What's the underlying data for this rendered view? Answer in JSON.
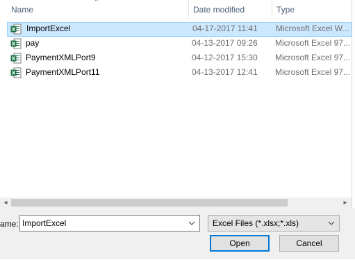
{
  "columns": {
    "name": "Name",
    "date_modified": "Date modified",
    "type": "Type"
  },
  "files": [
    {
      "name": "ImportExcel",
      "date": "04-17-2017 11:41",
      "type": "Microsoft Excel W...",
      "selected": true
    },
    {
      "name": "pay",
      "date": "04-13-2017 09:26",
      "type": "Microsoft Excel 97...",
      "selected": false
    },
    {
      "name": "PaymentXMLPort9",
      "date": "04-12-2017 15:30",
      "type": "Microsoft Excel 97...",
      "selected": false
    },
    {
      "name": "PaymentXMLPort11",
      "date": "04-13-2017 12:41",
      "type": "Microsoft Excel 97...",
      "selected": false
    }
  ],
  "file_name": {
    "label": "ame:",
    "value": "ImportExcel"
  },
  "file_type_filter": "Excel Files (*.xlsx;*.xls)",
  "buttons": {
    "open": "Open",
    "cancel": "Cancel"
  },
  "colors": {
    "selection_bg": "#cce8ff",
    "selection_border": "#99d1ff",
    "excel_green": "#1e7145",
    "focus_border": "#0078d7"
  },
  "icons": {
    "sort": "sort-up-icon",
    "file": "excel-file-icon",
    "dropdown": "chevron-down-icon"
  }
}
